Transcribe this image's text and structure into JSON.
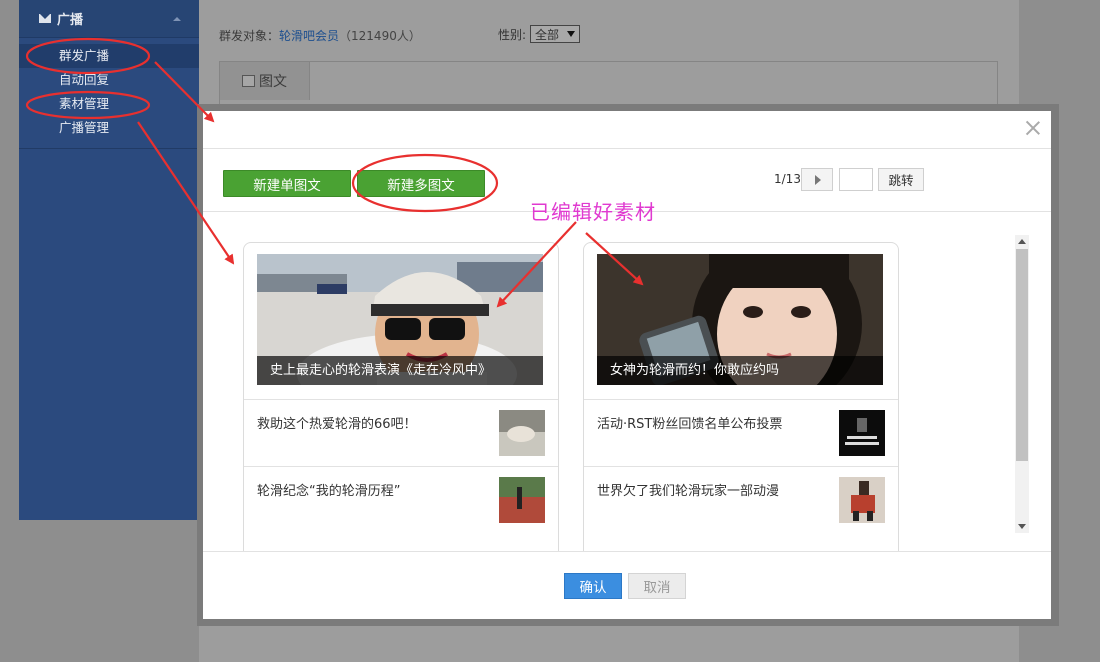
{
  "sidebar": {
    "section_title": "广播",
    "items": [
      {
        "label": "群发广播"
      },
      {
        "label": "自动回复"
      },
      {
        "label": "素材管理"
      },
      {
        "label": "广播管理"
      }
    ]
  },
  "background": {
    "target_label": "群发对象：",
    "target_link": "轮滑吧会员",
    "target_count": "（121490人）",
    "gender_label": "性别:",
    "gender_value": "全部",
    "tab_label": "图文"
  },
  "dialog": {
    "new_single_label": "新建单图文",
    "new_multi_label": "新建多图文",
    "pager": {
      "current": "1/13",
      "go_label": "跳转"
    },
    "cards": [
      {
        "cover_title": "史上最走心的轮滑表演《走在冷风中》",
        "items": [
          {
            "title": "救助这个热爱轮滑的66吧！"
          },
          {
            "title": "轮滑纪念“我的轮滑历程”"
          }
        ]
      },
      {
        "cover_title": "女神为轮滑而约！你敢应约吗",
        "items": [
          {
            "title": "活动·RST粉丝回馈名单公布投票"
          },
          {
            "title": "世界欠了我们轮滑玩家一部动漫"
          }
        ]
      }
    ],
    "confirm_label": "确认",
    "cancel_label": "取消"
  },
  "annotation": {
    "text": "已编辑好素材",
    "color": "#e03ad0",
    "ellipse_color": "#e8302f"
  }
}
